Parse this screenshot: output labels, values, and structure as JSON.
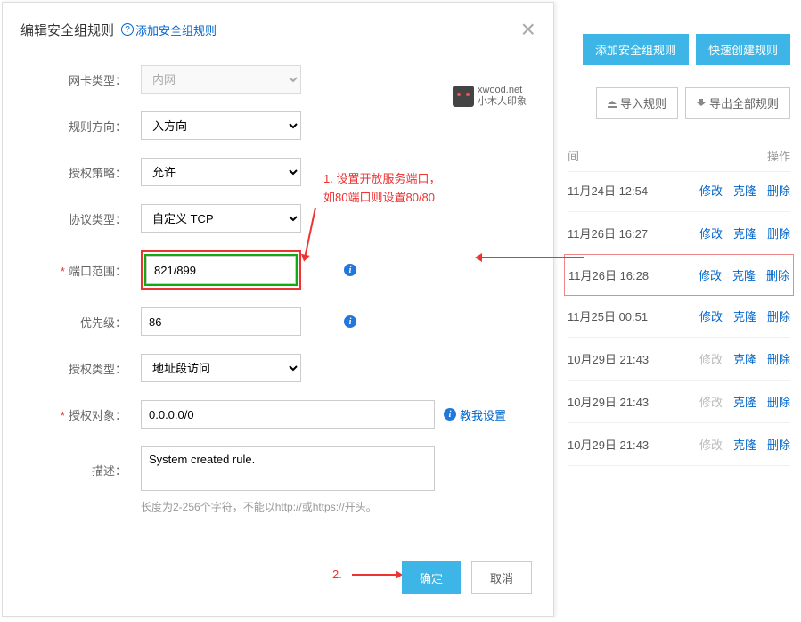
{
  "bg": {
    "btn_add": "添加安全组规则",
    "btn_quick": "快速创建规则",
    "btn_import": "导入规则",
    "btn_export": "导出全部规则",
    "head_time": "间",
    "head_op": "操作",
    "rows": [
      {
        "time": "11月24日 12:54",
        "op1": "修改",
        "op2": "克隆",
        "op3": "删除",
        "dis1": false
      },
      {
        "time": "11月26日 16:27",
        "op1": "修改",
        "op2": "克隆",
        "op3": "删除",
        "dis1": false
      },
      {
        "time": "11月26日 16:28",
        "op1": "修改",
        "op2": "克隆",
        "op3": "删除",
        "dis1": false,
        "hl": true
      },
      {
        "time": "11月25日 00:51",
        "op1": "修改",
        "op2": "克隆",
        "op3": "删除",
        "dis1": false
      },
      {
        "time": "10月29日 21:43",
        "op1": "修改",
        "op2": "克隆",
        "op3": "删除",
        "dis1": true
      },
      {
        "time": "10月29日 21:43",
        "op1": "修改",
        "op2": "克隆",
        "op3": "删除",
        "dis1": true
      },
      {
        "time": "10月29日 21:43",
        "op1": "修改",
        "op2": "克隆",
        "op3": "删除",
        "dis1": true
      }
    ]
  },
  "modal": {
    "title": "编辑安全组规则",
    "help": "添加安全组规则",
    "logo_line1": "xwood.net",
    "logo_line2": "小木人印象",
    "labels": {
      "nic": "网卡类型：",
      "dir": "规则方向：",
      "policy": "授权策略：",
      "proto": "协议类型：",
      "port": "端口范围：",
      "prio": "优先级：",
      "auth_type": "授权类型：",
      "auth_obj": "授权对象：",
      "desc": "描述："
    },
    "values": {
      "nic": "内网",
      "dir": "入方向",
      "policy": "允许",
      "proto": "自定义 TCP",
      "port": "821/899",
      "prio": "86",
      "auth_type": "地址段访问",
      "auth_obj": "0.0.0.0/0",
      "desc": "System created rule."
    },
    "teach": "教我设置",
    "hint": "长度为2-256个字符，不能以http://或https://开头。",
    "ok": "确定",
    "cancel": "取消"
  },
  "ann": {
    "line1": "1. 设置开放服务端口，",
    "line2": "如80端口则设置80/80",
    "step2": "2."
  }
}
